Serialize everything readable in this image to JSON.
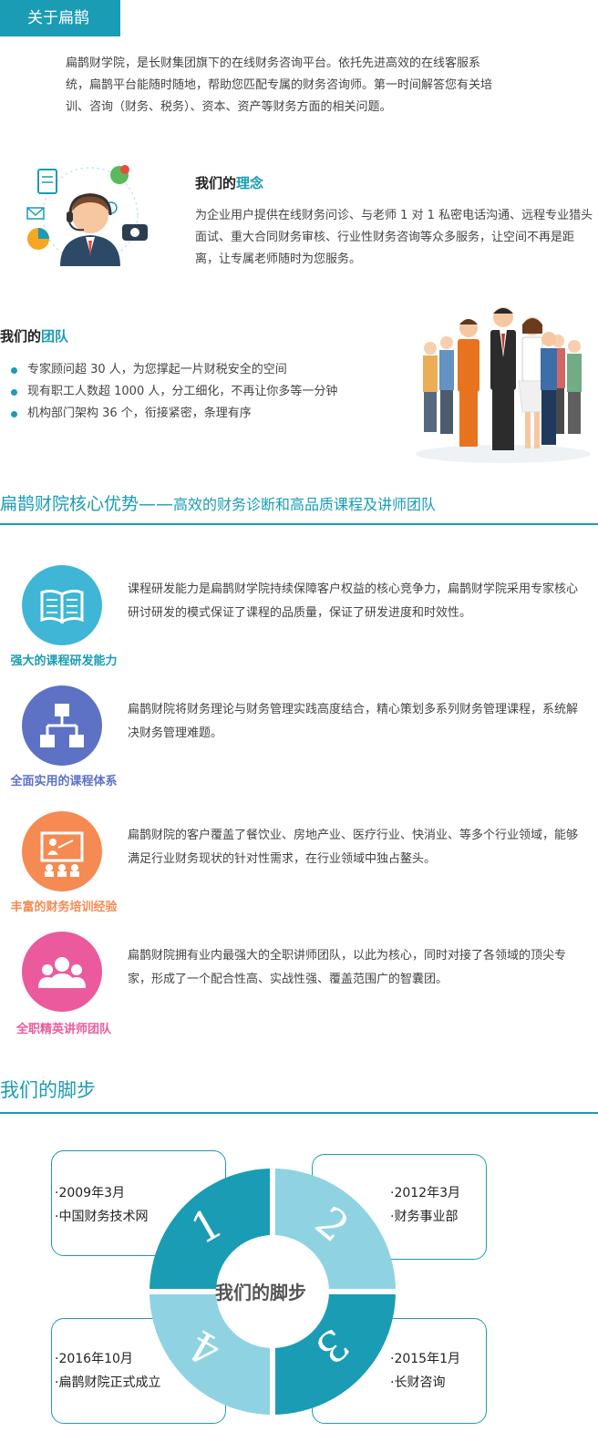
{
  "header": {
    "tab_label": "关于扁鹊"
  },
  "intro": {
    "text": "扁鹊财学院，是长财集团旗下的在线财务咨询平台。依托先进高效的在线客服系统，扁鹊平台能随时随地，帮助您匹配专属的财务咨询师。第一时间解答您有关培训、咨询（财务、税务）、资本、资产等财务方面的相关问题。"
  },
  "idea": {
    "title_prefix": "我们的",
    "title_highlight": "理念",
    "text": "为企业用户提供在线财务问诊、与老师 1 对 1 私密电话沟通、远程专业猎头面试、重大合同财务审核、行业性财务咨询等众多服务，让空间不再是距离，让专属老师随时为您服务。"
  },
  "team": {
    "title_prefix": "我们的",
    "title_highlight": "团队",
    "items": [
      "专家顾问超 30 人，为您撑起一片财税安全的空间",
      "现有职工人数超 1000 人，分工细化，不再让你多等一分钟",
      "机构部门架构 36 个，衔接紧密，条理有序"
    ]
  },
  "core": {
    "title_main": "扁鹊财院核心优势——",
    "title_sub": "高效的财务诊断和高品质课程及讲师团队",
    "advantages": [
      {
        "label": "强大的课程研发能力",
        "text": "课程研发能力是扁鹊财学院持续保障客户权益的核心竞争力，扁鹊财学院采用专家核心研讨研发的模式保证了课程的品质量，保证了研发进度和时效性。",
        "color": "#3fb6d6",
        "icon": "book-icon"
      },
      {
        "label": "全面实用的课程体系",
        "text": "扁鹊财院将财务理论与财务管理实践高度结合，精心策划多系列财务管理课程，系统解决财务管理难题。",
        "color": "#5d72c4",
        "icon": "hierarchy-icon"
      },
      {
        "label": "丰富的财务培训经验",
        "text": "扁鹊财院的客户覆盖了餐饮业、房地产业、医疗行业、快消业、等多个行业领域，能够满足行业财务现状的针对性需求，在行业领域中独占鳌头。",
        "color": "#f58a52",
        "icon": "training-icon"
      },
      {
        "label": "全职精英讲师团队",
        "text": "扁鹊财院拥有业内最强大的全职讲师团队，以此为核心，同时对接了各领域的顶尖专家，形成了一个配合性高、实战性强、覆盖范围广的智囊团。",
        "color": "#ea5a9c",
        "icon": "people-icon"
      }
    ]
  },
  "steps": {
    "title": "我们的脚步",
    "center_label": "我们的脚步",
    "items": [
      {
        "number": "1",
        "date": "·2009年3月",
        "desc": "·中国财务技术网"
      },
      {
        "number": "2",
        "date": "·2012年3月",
        "desc": "·财务事业部"
      },
      {
        "number": "3",
        "date": "·2015年1月",
        "desc": "·长财咨询"
      },
      {
        "number": "4",
        "date": "·2016年10月",
        "desc": "·扁鹊财院正式成立"
      }
    ],
    "colors": {
      "dark": "#1a9cb4",
      "light": "#8fd3e3"
    }
  }
}
